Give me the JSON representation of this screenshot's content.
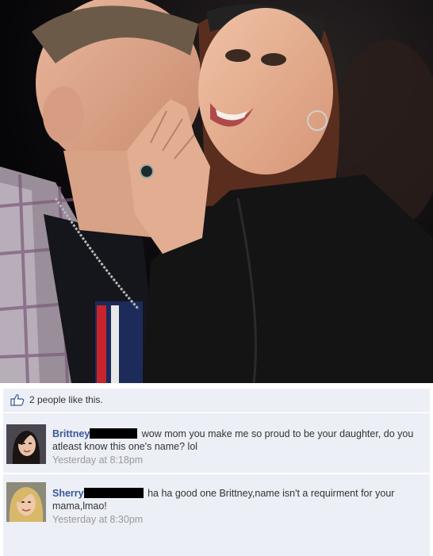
{
  "post": {
    "photo_icon": "couple-photo",
    "likes_icon": "thumbs-up-icon",
    "likes_text": "2 people like this."
  },
  "comments": [
    {
      "author": "Brittney",
      "text": "wow mom you make me so proud to be your daughter, do you atleast know this one's name? lol",
      "timestamp": "Yesterday at 8:18pm"
    },
    {
      "author": "Sherry",
      "text": "ha ha good one Brittney,name isn't a requirment for your mama,lmao!",
      "timestamp": "Yesterday at 8:30pm"
    }
  ],
  "colors": {
    "link_blue": "#3b5998",
    "comment_bg": "#eceff5",
    "timestamp_gray": "#999999"
  }
}
